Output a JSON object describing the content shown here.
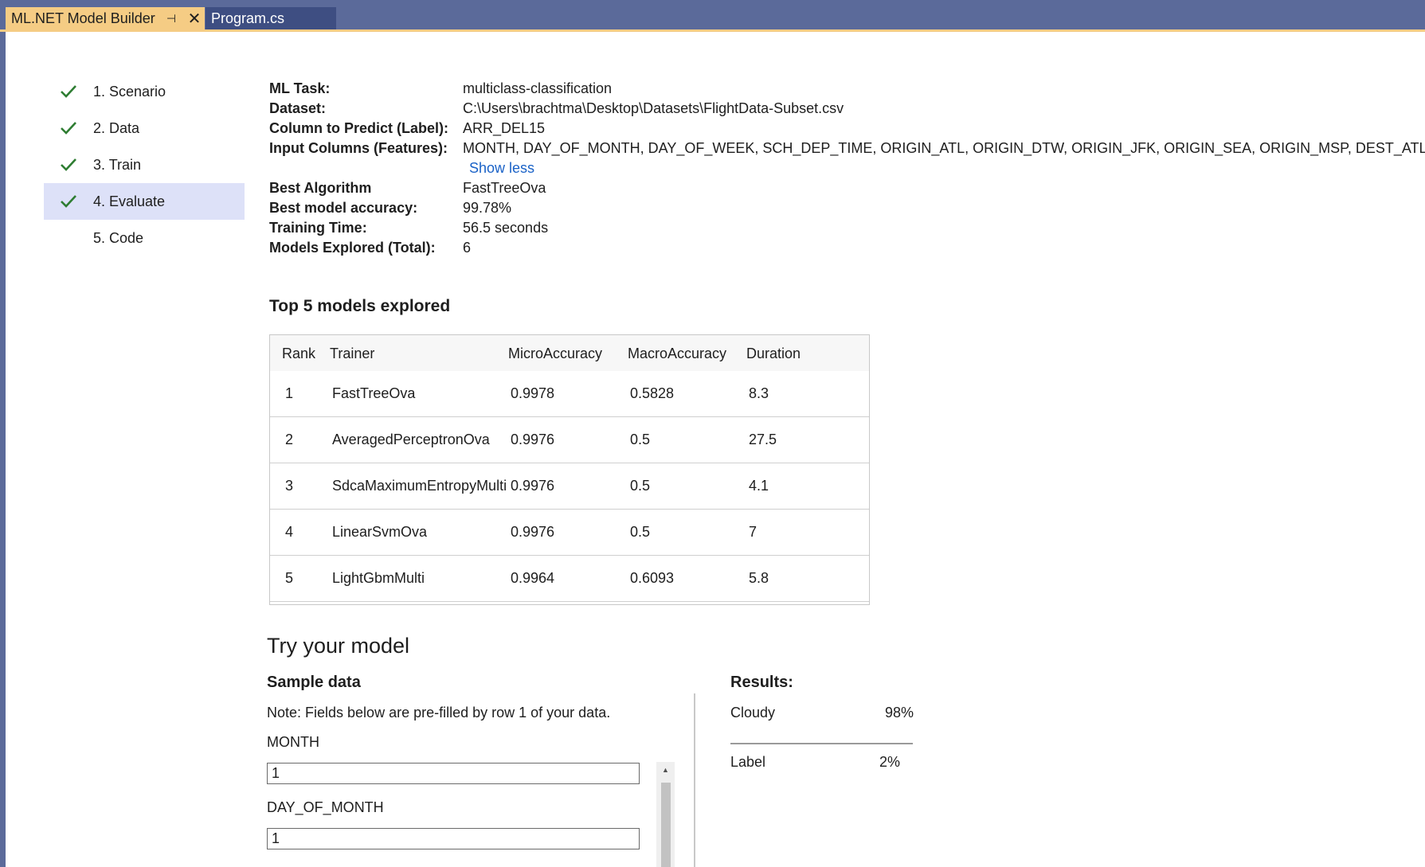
{
  "tabs": {
    "active_label": "ML.NET Model Builder",
    "pin_glyph": "⊣",
    "close_glyph": "✕",
    "inactive_label": "Program.cs"
  },
  "steps": [
    {
      "label": "1. Scenario",
      "done": true
    },
    {
      "label": "2. Data",
      "done": true
    },
    {
      "label": "3. Train",
      "done": true
    },
    {
      "label": "4. Evaluate",
      "done": true,
      "selected": true
    },
    {
      "label": "5. Code",
      "done": false
    }
  ],
  "summary": {
    "ml_task_key": "ML Task:",
    "ml_task_val": "multiclass-classification",
    "dataset_key": "Dataset:",
    "dataset_val": "C:\\Users\\brachtma\\Desktop\\Datasets\\FlightData-Subset.csv",
    "label_key": "Column to Predict (Label):",
    "label_val": "ARR_DEL15",
    "features_key": "Input Columns (Features):",
    "features_val": "MONTH, DAY_OF_MONTH, DAY_OF_WEEK, SCH_DEP_TIME, ORIGIN_ATL, ORIGIN_DTW, ORIGIN_JFK, ORIGIN_SEA, ORIGIN_MSP, DEST_ATL, DEST_DTW, D",
    "show_less": "Show less",
    "algo_key": "Best Algorithm",
    "algo_val": "FastTreeOva",
    "accuracy_key": "Best model accuracy:",
    "accuracy_val": "99.78%",
    "time_key": "Training Time:",
    "time_val": "56.5 seconds",
    "models_key": "Models Explored (Total):",
    "models_val": "6"
  },
  "top_models": {
    "title": "Top 5 models explored",
    "headers": [
      "Rank",
      "Trainer",
      "MicroAccuracy",
      "MacroAccuracy",
      "Duration"
    ],
    "rows": [
      [
        "1",
        "FastTreeOva",
        "0.9978",
        "0.5828",
        "8.3"
      ],
      [
        "2",
        "AveragedPerceptronOva",
        "0.9976",
        "0.5",
        "27.5"
      ],
      [
        "3",
        "SdcaMaximumEntropyMulti",
        "0.9976",
        "0.5",
        "4.1"
      ],
      [
        "4",
        "LinearSvmOva",
        "0.9976",
        "0.5",
        "7"
      ],
      [
        "5",
        "LightGbmMulti",
        "0.9964",
        "0.6093",
        "5.8"
      ]
    ]
  },
  "try_model": {
    "title": "Try your model",
    "sample_title": "Sample data",
    "note": "Note: Fields below are pre-filled by row 1 of your data.",
    "fields": [
      {
        "label": "MONTH",
        "value": "1"
      },
      {
        "label": "DAY_OF_MONTH",
        "value": "1"
      }
    ],
    "scroll_up_glyph": "▲"
  },
  "results": {
    "title": "Results:",
    "items": [
      {
        "label": "Cloudy",
        "value": "98%"
      },
      {
        "label": "Label",
        "value": "2%"
      }
    ]
  },
  "colors": {
    "accent_tab": "#f5cc84",
    "selected_step": "#dde1f8",
    "check": "#2e7d32",
    "link": "#1a62c7"
  }
}
